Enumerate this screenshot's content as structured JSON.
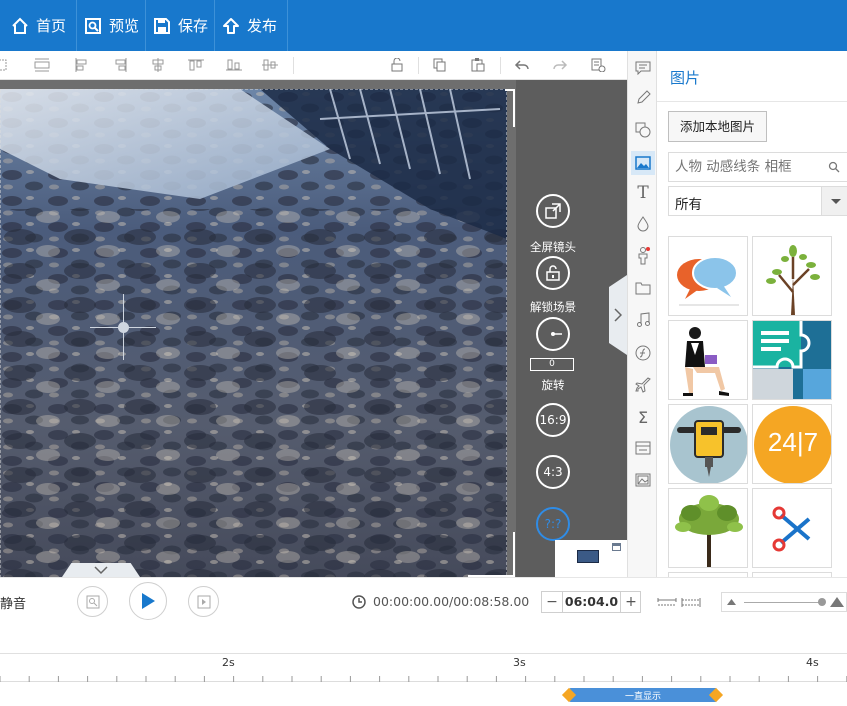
{
  "topbar": {
    "home": "首页",
    "preview": "预览",
    "save": "保存",
    "publish": "发布"
  },
  "camera": {
    "fullscreen": "全屏镜头",
    "unlock": "解锁场景",
    "rotate_value": "0",
    "rotate": "旋转",
    "ratio_169": "16:9",
    "ratio_43": "4:3",
    "ratio_custom": "?:?"
  },
  "panel": {
    "title": "图片",
    "add_local": "添加本地图片",
    "search_placeholder": "人物 动感线条 相框",
    "filter_selected": "所有",
    "thumb_247": "24|7"
  },
  "playback": {
    "mute": "静音",
    "time": "00:00:00.00/00:08:58.00",
    "duration": "06:04.0",
    "minus": "−",
    "plus": "+"
  },
  "timeline": {
    "ticks": [
      "2s",
      "3s",
      "4s"
    ],
    "clip_label": "一直显示"
  },
  "colors": {
    "brand": "#1878cc",
    "play": "#1878cc",
    "clip": "#4a90d9",
    "clip_handle": "#f5a623"
  }
}
